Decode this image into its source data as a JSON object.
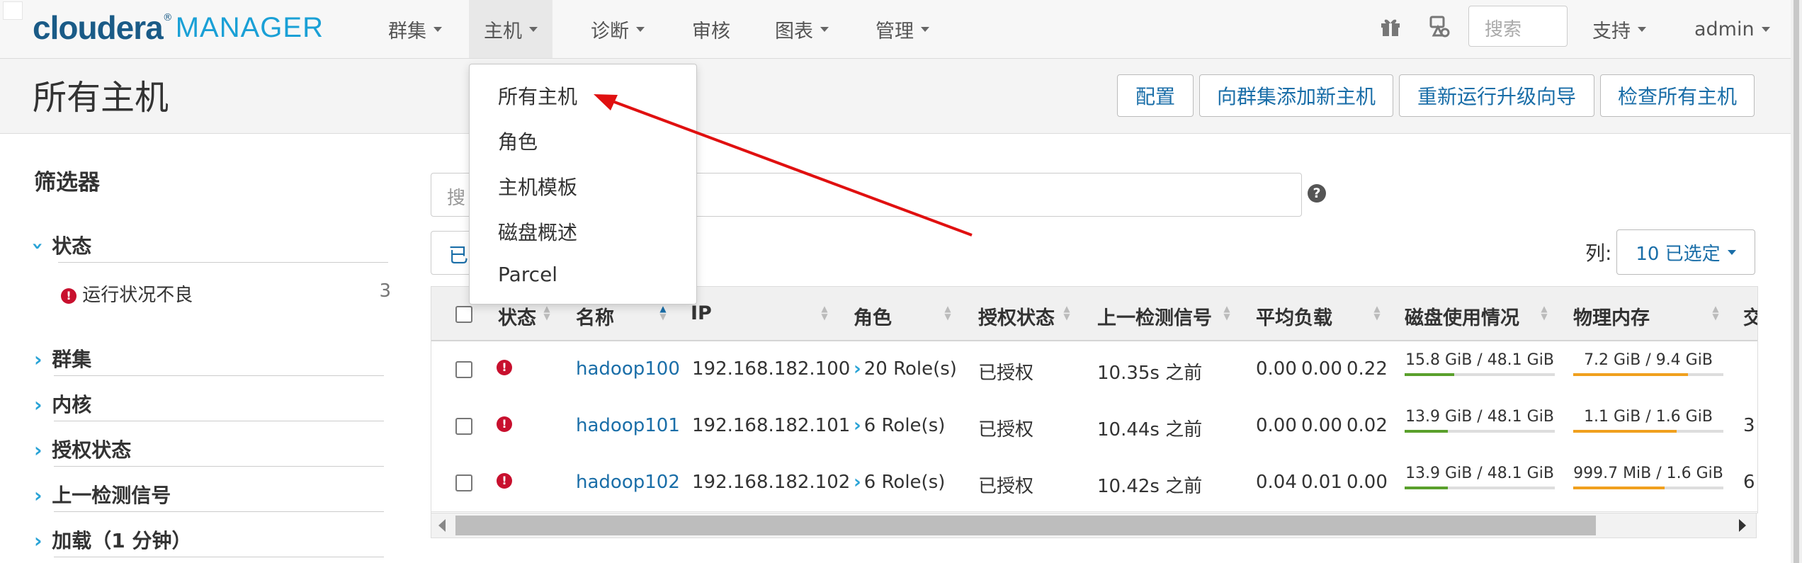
{
  "nav": {
    "logo_brand": "cloudera",
    "logo_product": "MANAGER",
    "items": [
      "群集",
      "主机",
      "诊断",
      "审核",
      "图表",
      "管理"
    ],
    "search_placeholder": "搜索",
    "support": "支持",
    "user": "admin",
    "icons": [
      "gift-icon",
      "support-icon"
    ]
  },
  "header": {
    "title": "所有主机",
    "buttons": [
      "配置",
      "向群集添加新主机",
      "重新运行升级向导",
      "检查所有主机"
    ]
  },
  "dropdown": {
    "items": [
      "所有主机",
      "角色",
      "主机模板",
      "磁盘概述",
      "Parcel"
    ]
  },
  "sidebar": {
    "title": "筛选器",
    "sections": [
      {
        "label": "状态",
        "expanded": true
      },
      {
        "label": "群集",
        "expanded": false
      },
      {
        "label": "内核",
        "expanded": false
      },
      {
        "label": "授权状态",
        "expanded": false
      },
      {
        "label": "上一检测信号",
        "expanded": false
      },
      {
        "label": "加载（1 分钟）",
        "expanded": false
      }
    ],
    "status_item": {
      "label": "运行状况不良",
      "count": "3"
    }
  },
  "main": {
    "search_placeholder": "搜",
    "chip_label": "已",
    "columns_label": "列:",
    "columns_selected": "10 已选定",
    "headers": [
      "状态",
      "名称",
      "IP",
      "角色",
      "授权状态",
      "上一检测信号",
      "平均负载",
      "磁盘使用情况",
      "物理内存",
      "交"
    ],
    "rows": [
      {
        "name": "hadoop100",
        "ip": "192.168.182.100",
        "roles": "20 Role(s)",
        "auth": "已授权",
        "heartbeat": "10.35s 之前",
        "load": [
          "0.00",
          "0.00",
          "0.22"
        ],
        "disk": "15.8 GiB / 48.1 GiB",
        "disk_pct": 32.8,
        "mem": "7.2 GiB / 9.4 GiB",
        "mem_pct": 76.6,
        "extra": ""
      },
      {
        "name": "hadoop101",
        "ip": "192.168.182.101",
        "roles": "6 Role(s)",
        "auth": "已授权",
        "heartbeat": "10.44s 之前",
        "load": [
          "0.00",
          "0.00",
          "0.02"
        ],
        "disk": "13.9 GiB / 48.1 GiB",
        "disk_pct": 28.9,
        "mem": "1.1 GiB / 1.6 GiB",
        "mem_pct": 68.8,
        "extra": "3"
      },
      {
        "name": "hadoop102",
        "ip": "192.168.182.102",
        "roles": "6 Role(s)",
        "auth": "已授权",
        "heartbeat": "10.42s 之前",
        "load": [
          "0.04",
          "0.01",
          "0.00"
        ],
        "disk": "13.9 GiB / 48.1 GiB",
        "disk_pct": 28.9,
        "mem": "999.7 MiB / 1.6 GiB",
        "mem_pct": 61.0,
        "extra": "6"
      }
    ]
  },
  "colors": {
    "link": "#1a6ea8",
    "brand": "#1a5b87",
    "error": "#c8102e",
    "disk_bar": "#5aa02c",
    "mem_bar": "#f0a01e",
    "annotation_arrow": "#e01010"
  }
}
